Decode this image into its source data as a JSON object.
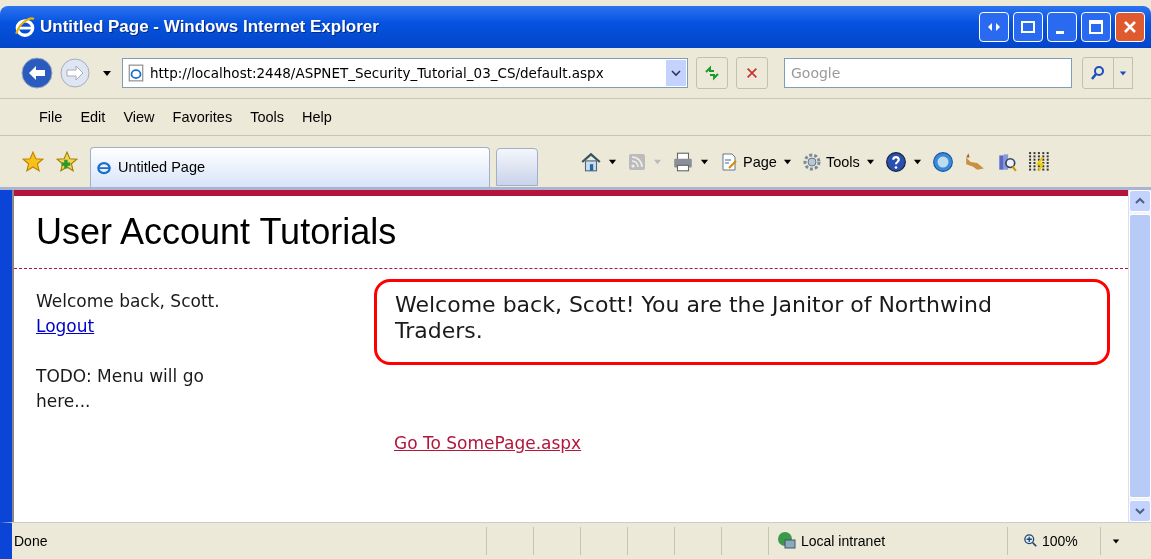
{
  "window": {
    "title": "Untitled Page - Windows Internet Explorer"
  },
  "address_bar": {
    "url": "http://localhost:2448/ASPNET_Security_Tutorial_03_CS/default.aspx"
  },
  "search": {
    "placeholder": "Google"
  },
  "menu": [
    {
      "label": "File"
    },
    {
      "label": "Edit"
    },
    {
      "label": "View"
    },
    {
      "label": "Favorites"
    },
    {
      "label": "Tools"
    },
    {
      "label": "Help"
    }
  ],
  "tabs": [
    {
      "label": "Untitled Page",
      "selected": true
    }
  ],
  "command_bar": [
    {
      "kind": "home"
    },
    {
      "kind": "feed"
    },
    {
      "kind": "print"
    },
    {
      "kind": "page",
      "label": "Page"
    },
    {
      "kind": "tools",
      "label": "Tools"
    },
    {
      "kind": "help"
    }
  ],
  "page": {
    "heading": "User Account Tutorials",
    "welcome": "Welcome back, Scott.",
    "logout": "Logout",
    "todo": "TODO: Menu will go here...",
    "message": "Welcome back, Scott! You are the Janitor of Northwind Traders.",
    "link": "Go To SomePage.aspx"
  },
  "status_bar": {
    "status": "Done",
    "zone": "Local intranet",
    "zoom": "100%"
  }
}
